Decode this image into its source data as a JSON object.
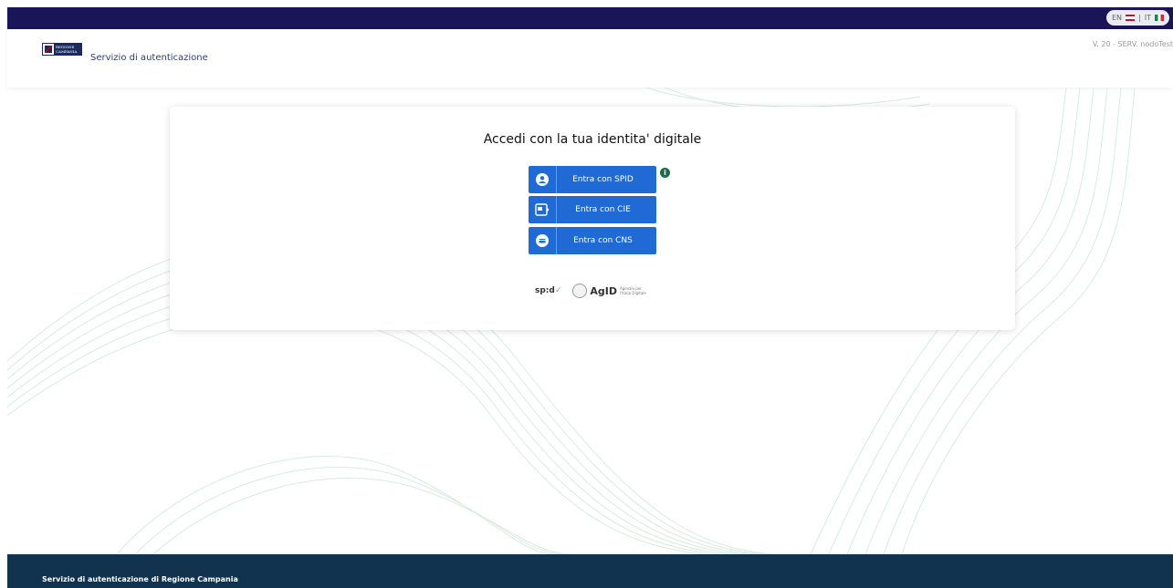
{
  "topbar": {
    "lang_en": "EN",
    "lang_it": "IT"
  },
  "header": {
    "logo_text_line1": "REGIONE",
    "logo_text_line2": "CAMPANIA",
    "title": "Servizio di autenticazione",
    "version": "V. 20 - SERV. nodoTest"
  },
  "main": {
    "title": "Accedi con la tua identita' digitale",
    "buttons": [
      {
        "label": "Entra con SPID",
        "icon": "user-icon"
      },
      {
        "label": "Entra con CIE",
        "icon": "id-card-icon"
      },
      {
        "label": "Entra con CNS",
        "icon": "card-icon"
      }
    ],
    "info_badge": "i",
    "brands": {
      "spid": "sp:d",
      "agid": "AgID",
      "agid_sub": "Agenzia per l'Italia Digitale"
    }
  },
  "footer": {
    "text": "Servizio di autenticazione di Regione Campania"
  },
  "colors": {
    "topbar": "#1a1458",
    "button": "#1f6ad4",
    "footer": "#113350",
    "wave": "#cfe3d5",
    "info": "#1d6b4a"
  }
}
